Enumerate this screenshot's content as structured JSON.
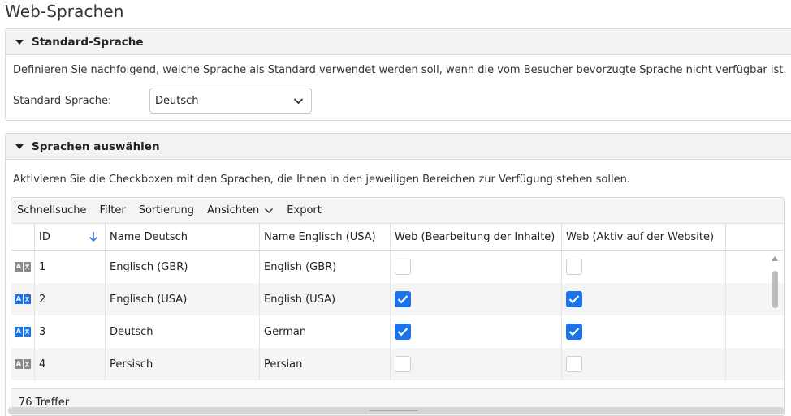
{
  "page_title": "Web-Sprachen",
  "default_section": {
    "title": "Standard-Sprache",
    "description": "Definieren Sie nachfolgend, welche Sprache als Standard verwendet werden soll, wenn die vom Besucher bevorzugte Sprache nicht verfügbar ist.",
    "label": "Standard-Sprache:",
    "selected": "Deutsch"
  },
  "select_section": {
    "title": "Sprachen auswählen",
    "description": "Aktivieren Sie die Checkboxen mit den Sprachen, die Ihnen in den jeweiligen Bereichen zur Verfügung stehen sollen."
  },
  "toolbar": {
    "quick_search": "Schnellsuche",
    "filter": "Filter",
    "sort": "Sortierung",
    "views": "Ansichten",
    "export": "Export"
  },
  "columns": {
    "id": "ID",
    "name_de": "Name Deutsch",
    "name_en": "Name Englisch (USA)",
    "web_edit": "Web (Bearbeitung der Inhalte)",
    "web_active": "Web (Aktiv auf der Website)"
  },
  "rows": [
    {
      "id": "1",
      "name_de": "Englisch (GBR)",
      "name_en": "English (GBR)",
      "web_edit": false,
      "web_active": false,
      "active": false
    },
    {
      "id": "2",
      "name_de": "Englisch (USA)",
      "name_en": "English (USA)",
      "web_edit": true,
      "web_active": true,
      "active": true
    },
    {
      "id": "3",
      "name_de": "Deutsch",
      "name_en": "German",
      "web_edit": true,
      "web_active": true,
      "active": true
    },
    {
      "id": "4",
      "name_de": "Persisch",
      "name_en": "Persian",
      "web_edit": false,
      "web_active": false,
      "active": false
    }
  ],
  "footer": {
    "count_text": "76 Treffer"
  },
  "colors": {
    "accent": "#1a73e8",
    "inactive_icon": "#8a8a8a"
  },
  "icons": {
    "section_toggle": "caret-down-icon",
    "language": "language-icon",
    "sort": "arrow-down-icon",
    "dropdown": "chevron-down-icon",
    "check": "check-icon"
  }
}
